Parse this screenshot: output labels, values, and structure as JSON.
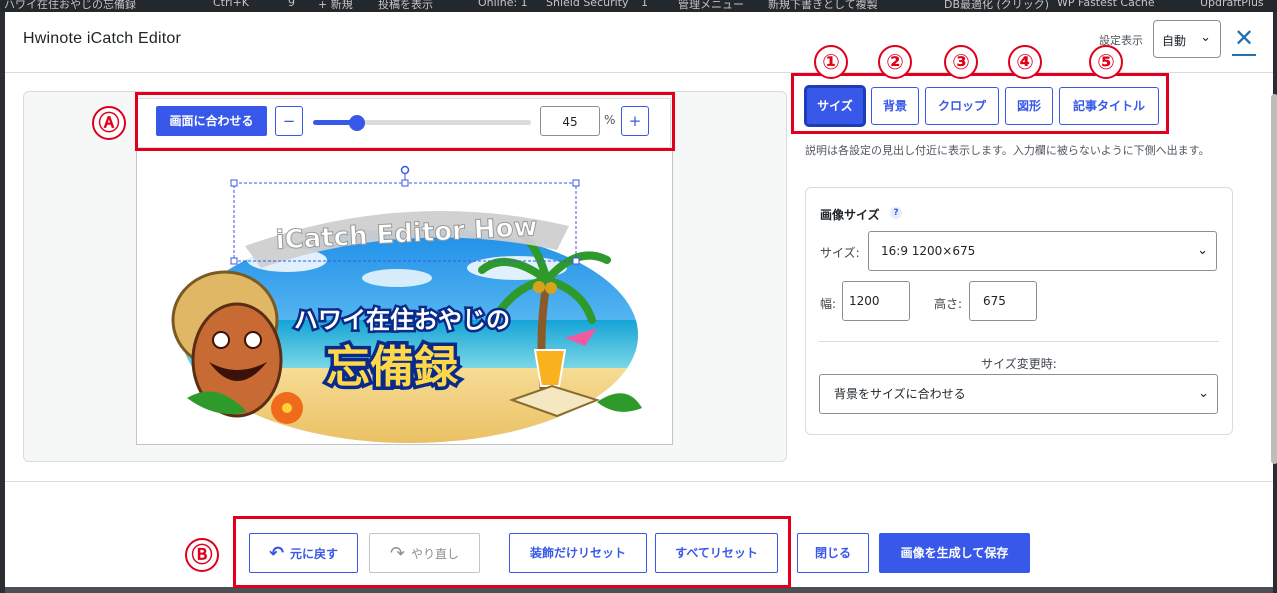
{
  "background_bar": {
    "items": [
      "ハワイ在住おやじの忘備録",
      "Ctrl+K",
      "9",
      "+ 新規",
      "投稿を表示",
      "Online: 1",
      "Shield Security",
      "1",
      "管理メニュー",
      "新規下書きとして複製",
      "DB最適化 (クリック)",
      "WP Fastest Cache",
      "UpdraftPlus"
    ]
  },
  "modal": {
    "title": "Hwinote iCatch Editor",
    "view_label": "設定表示",
    "view_select_value": "自動",
    "close_symbol": "✕"
  },
  "toolbar": {
    "fit_label": "画面に合わせる",
    "minus": "−",
    "plus": "+",
    "zoom_value": "45",
    "zoom_unit": "%",
    "zoom_fraction": 0.2
  },
  "canvas": {
    "arc_title": "iCatch Editor How",
    "main_title_line1": "ハワイ在住おやじの",
    "main_title_line2": "忘備録"
  },
  "tabs": [
    {
      "label": "サイズ",
      "active": true
    },
    {
      "label": "背景",
      "active": false
    },
    {
      "label": "クロップ",
      "active": false
    },
    {
      "label": "図形",
      "active": false
    },
    {
      "label": "記事タイトル",
      "active": false
    }
  ],
  "hint": "説明は各設定の見出し付近に表示します。入力欄に被らないように下側へ出ます。",
  "size_card": {
    "title": "画像サイズ",
    "help_icon": "?",
    "size_label": "サイズ:",
    "size_value": "16:9 1200×675",
    "width_label": "幅:",
    "width_value": "1200",
    "height_label": "高さ:",
    "height_value": "675",
    "on_change_label": "サイズ変更時:",
    "on_change_value": "背景をサイズに合わせる"
  },
  "footer": {
    "undo": "元に戻す",
    "redo": "やり直し",
    "reset_decor": "装飾だけリセット",
    "reset_all": "すべてリセット",
    "close": "閉じる",
    "save": "画像を生成して保存"
  },
  "annotations": {
    "A": "Ⓐ",
    "B": "Ⓑ",
    "n1": "①",
    "n2": "②",
    "n3": "③",
    "n4": "④",
    "n5": "⑤"
  },
  "colors": {
    "accent": "#3858e9",
    "annotation_red": "#e0001b"
  }
}
